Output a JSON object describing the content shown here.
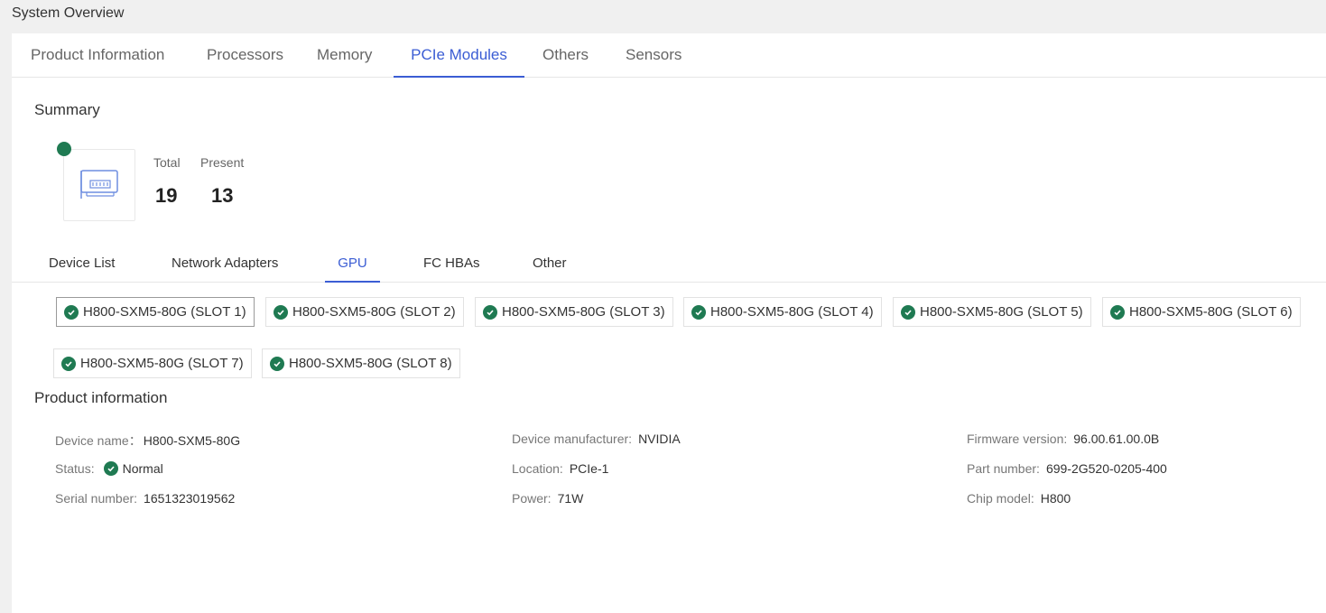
{
  "page_title": "System Overview",
  "top_tabs": [
    {
      "label": "Product Information"
    },
    {
      "label": "Processors"
    },
    {
      "label": "Memory"
    },
    {
      "label": "PCIe Modules",
      "active": true
    },
    {
      "label": "Others"
    },
    {
      "label": "Sensors"
    }
  ],
  "summary": {
    "title": "Summary",
    "icon": "pcie-card-icon",
    "status_color": "#1f7a52",
    "total_label": "Total",
    "total_value": "19",
    "present_label": "Present",
    "present_value": "13"
  },
  "sub_tabs": [
    {
      "label": "Device List"
    },
    {
      "label": "Network Adapters"
    },
    {
      "label": "GPU",
      "active": true
    },
    {
      "label": "FC HBAs"
    },
    {
      "label": "Other"
    }
  ],
  "gpu_slots": [
    {
      "label": "H800-SXM5-80G (SLOT 1)",
      "selected": true
    },
    {
      "label": "H800-SXM5-80G (SLOT 2)"
    },
    {
      "label": "H800-SXM5-80G (SLOT 3)"
    },
    {
      "label": "H800-SXM5-80G (SLOT 4)"
    },
    {
      "label": "H800-SXM5-80G (SLOT 5)"
    },
    {
      "label": "H800-SXM5-80G (SLOT 6)"
    },
    {
      "label": "H800-SXM5-80G (SLOT 7)"
    },
    {
      "label": "H800-SXM5-80G (SLOT 8)"
    }
  ],
  "product_info": {
    "title": "Product information",
    "device_name_label": "Device name：",
    "device_name": "H800-SXM5-80G",
    "status_label": "Status:",
    "status": "Normal",
    "serial_label": "Serial number:",
    "serial": "1651323019562",
    "manufacturer_label": "Device manufacturer:",
    "manufacturer": "NVIDIA",
    "location_label": "Location:",
    "location": "PCIe-1",
    "power_label": "Power:",
    "power": "71W",
    "firmware_label": "Firmware version:",
    "firmware": "96.00.61.00.0B",
    "part_label": "Part number:",
    "part": "699-2G520-0205-400",
    "chip_label": "Chip model:",
    "chip": "H800"
  },
  "colors": {
    "accent": "#3b5dd4",
    "ok_green": "#1f7a52"
  }
}
